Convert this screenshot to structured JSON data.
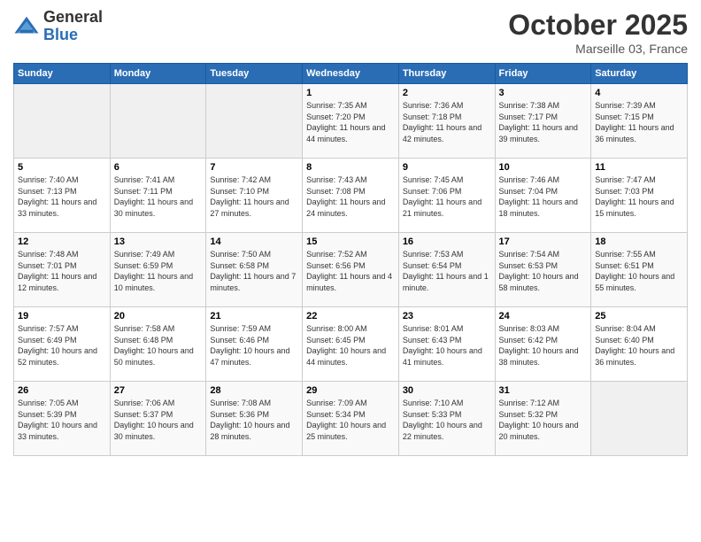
{
  "logo": {
    "general": "General",
    "blue": "Blue"
  },
  "title": "October 2025",
  "subtitle": "Marseille 03, France",
  "days_of_week": [
    "Sunday",
    "Monday",
    "Tuesday",
    "Wednesday",
    "Thursday",
    "Friday",
    "Saturday"
  ],
  "weeks": [
    [
      {
        "day": "",
        "info": ""
      },
      {
        "day": "",
        "info": ""
      },
      {
        "day": "",
        "info": ""
      },
      {
        "day": "1",
        "info": "Sunrise: 7:35 AM\nSunset: 7:20 PM\nDaylight: 11 hours and 44 minutes."
      },
      {
        "day": "2",
        "info": "Sunrise: 7:36 AM\nSunset: 7:18 PM\nDaylight: 11 hours and 42 minutes."
      },
      {
        "day": "3",
        "info": "Sunrise: 7:38 AM\nSunset: 7:17 PM\nDaylight: 11 hours and 39 minutes."
      },
      {
        "day": "4",
        "info": "Sunrise: 7:39 AM\nSunset: 7:15 PM\nDaylight: 11 hours and 36 minutes."
      }
    ],
    [
      {
        "day": "5",
        "info": "Sunrise: 7:40 AM\nSunset: 7:13 PM\nDaylight: 11 hours and 33 minutes."
      },
      {
        "day": "6",
        "info": "Sunrise: 7:41 AM\nSunset: 7:11 PM\nDaylight: 11 hours and 30 minutes."
      },
      {
        "day": "7",
        "info": "Sunrise: 7:42 AM\nSunset: 7:10 PM\nDaylight: 11 hours and 27 minutes."
      },
      {
        "day": "8",
        "info": "Sunrise: 7:43 AM\nSunset: 7:08 PM\nDaylight: 11 hours and 24 minutes."
      },
      {
        "day": "9",
        "info": "Sunrise: 7:45 AM\nSunset: 7:06 PM\nDaylight: 11 hours and 21 minutes."
      },
      {
        "day": "10",
        "info": "Sunrise: 7:46 AM\nSunset: 7:04 PM\nDaylight: 11 hours and 18 minutes."
      },
      {
        "day": "11",
        "info": "Sunrise: 7:47 AM\nSunset: 7:03 PM\nDaylight: 11 hours and 15 minutes."
      }
    ],
    [
      {
        "day": "12",
        "info": "Sunrise: 7:48 AM\nSunset: 7:01 PM\nDaylight: 11 hours and 12 minutes."
      },
      {
        "day": "13",
        "info": "Sunrise: 7:49 AM\nSunset: 6:59 PM\nDaylight: 11 hours and 10 minutes."
      },
      {
        "day": "14",
        "info": "Sunrise: 7:50 AM\nSunset: 6:58 PM\nDaylight: 11 hours and 7 minutes."
      },
      {
        "day": "15",
        "info": "Sunrise: 7:52 AM\nSunset: 6:56 PM\nDaylight: 11 hours and 4 minutes."
      },
      {
        "day": "16",
        "info": "Sunrise: 7:53 AM\nSunset: 6:54 PM\nDaylight: 11 hours and 1 minute."
      },
      {
        "day": "17",
        "info": "Sunrise: 7:54 AM\nSunset: 6:53 PM\nDaylight: 10 hours and 58 minutes."
      },
      {
        "day": "18",
        "info": "Sunrise: 7:55 AM\nSunset: 6:51 PM\nDaylight: 10 hours and 55 minutes."
      }
    ],
    [
      {
        "day": "19",
        "info": "Sunrise: 7:57 AM\nSunset: 6:49 PM\nDaylight: 10 hours and 52 minutes."
      },
      {
        "day": "20",
        "info": "Sunrise: 7:58 AM\nSunset: 6:48 PM\nDaylight: 10 hours and 50 minutes."
      },
      {
        "day": "21",
        "info": "Sunrise: 7:59 AM\nSunset: 6:46 PM\nDaylight: 10 hours and 47 minutes."
      },
      {
        "day": "22",
        "info": "Sunrise: 8:00 AM\nSunset: 6:45 PM\nDaylight: 10 hours and 44 minutes."
      },
      {
        "day": "23",
        "info": "Sunrise: 8:01 AM\nSunset: 6:43 PM\nDaylight: 10 hours and 41 minutes."
      },
      {
        "day": "24",
        "info": "Sunrise: 8:03 AM\nSunset: 6:42 PM\nDaylight: 10 hours and 38 minutes."
      },
      {
        "day": "25",
        "info": "Sunrise: 8:04 AM\nSunset: 6:40 PM\nDaylight: 10 hours and 36 minutes."
      }
    ],
    [
      {
        "day": "26",
        "info": "Sunrise: 7:05 AM\nSunset: 5:39 PM\nDaylight: 10 hours and 33 minutes."
      },
      {
        "day": "27",
        "info": "Sunrise: 7:06 AM\nSunset: 5:37 PM\nDaylight: 10 hours and 30 minutes."
      },
      {
        "day": "28",
        "info": "Sunrise: 7:08 AM\nSunset: 5:36 PM\nDaylight: 10 hours and 28 minutes."
      },
      {
        "day": "29",
        "info": "Sunrise: 7:09 AM\nSunset: 5:34 PM\nDaylight: 10 hours and 25 minutes."
      },
      {
        "day": "30",
        "info": "Sunrise: 7:10 AM\nSunset: 5:33 PM\nDaylight: 10 hours and 22 minutes."
      },
      {
        "day": "31",
        "info": "Sunrise: 7:12 AM\nSunset: 5:32 PM\nDaylight: 10 hours and 20 minutes."
      },
      {
        "day": "",
        "info": ""
      }
    ]
  ]
}
